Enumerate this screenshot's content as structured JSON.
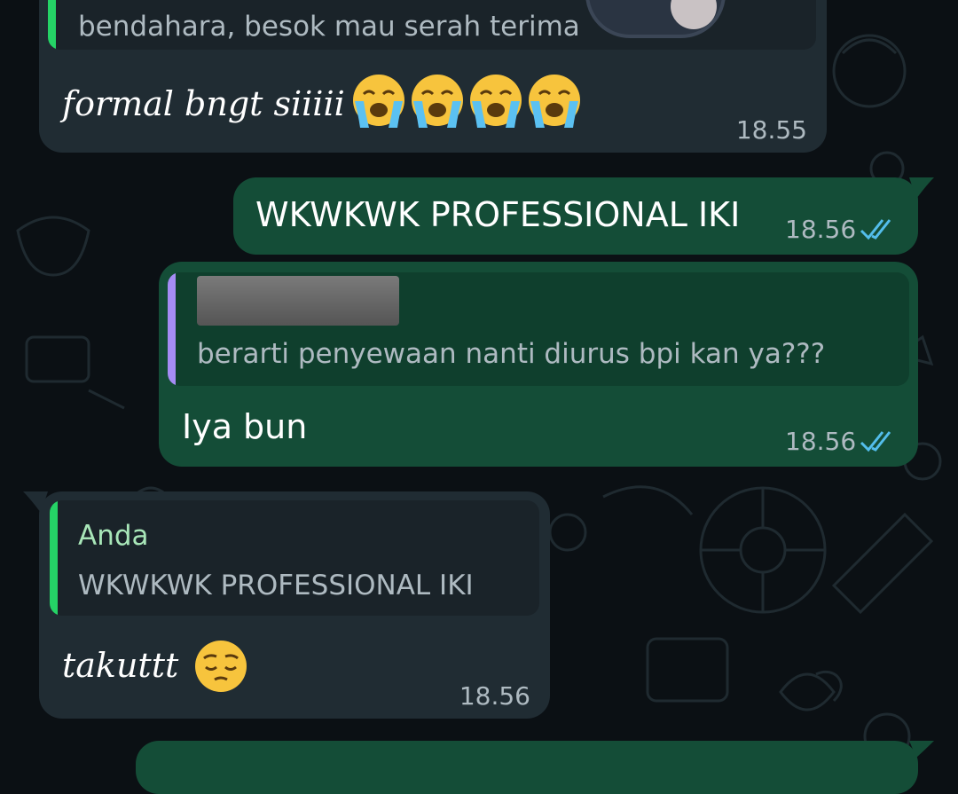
{
  "colors": {
    "incoming_bubble": "#202c33",
    "outgoing_bubble": "#144d37",
    "quote_bar_green": "#25d366",
    "quote_bar_purple": "#a58cf5",
    "read_ticks": "#53bdeb"
  },
  "messages": [
    {
      "direction": "incoming",
      "quote_text": "bendahara, besok mau serah terima",
      "text": "formal bngt siiiii",
      "emoji": [
        "loudly-crying-face-icon",
        "loudly-crying-face-icon",
        "loudly-crying-face-icon",
        "loudly-crying-face-icon"
      ],
      "time": "18.55"
    },
    {
      "direction": "outgoing",
      "text": "WKWKWK PROFESSIONAL IKI",
      "time": "18.56",
      "status_icon": "double-check-read-icon"
    },
    {
      "direction": "outgoing",
      "quote_text": "berarti penyewaan nanti diurus bpi kan ya???",
      "text": "Iya bun",
      "time": "18.56",
      "status_icon": "double-check-read-icon"
    },
    {
      "direction": "incoming",
      "quote_sender": "Anda",
      "quote_text": "WKWKWK PROFESSIONAL IKI",
      "text": "takuttt",
      "emoji": [
        "pensive-face-icon"
      ],
      "time": "18.56"
    }
  ]
}
